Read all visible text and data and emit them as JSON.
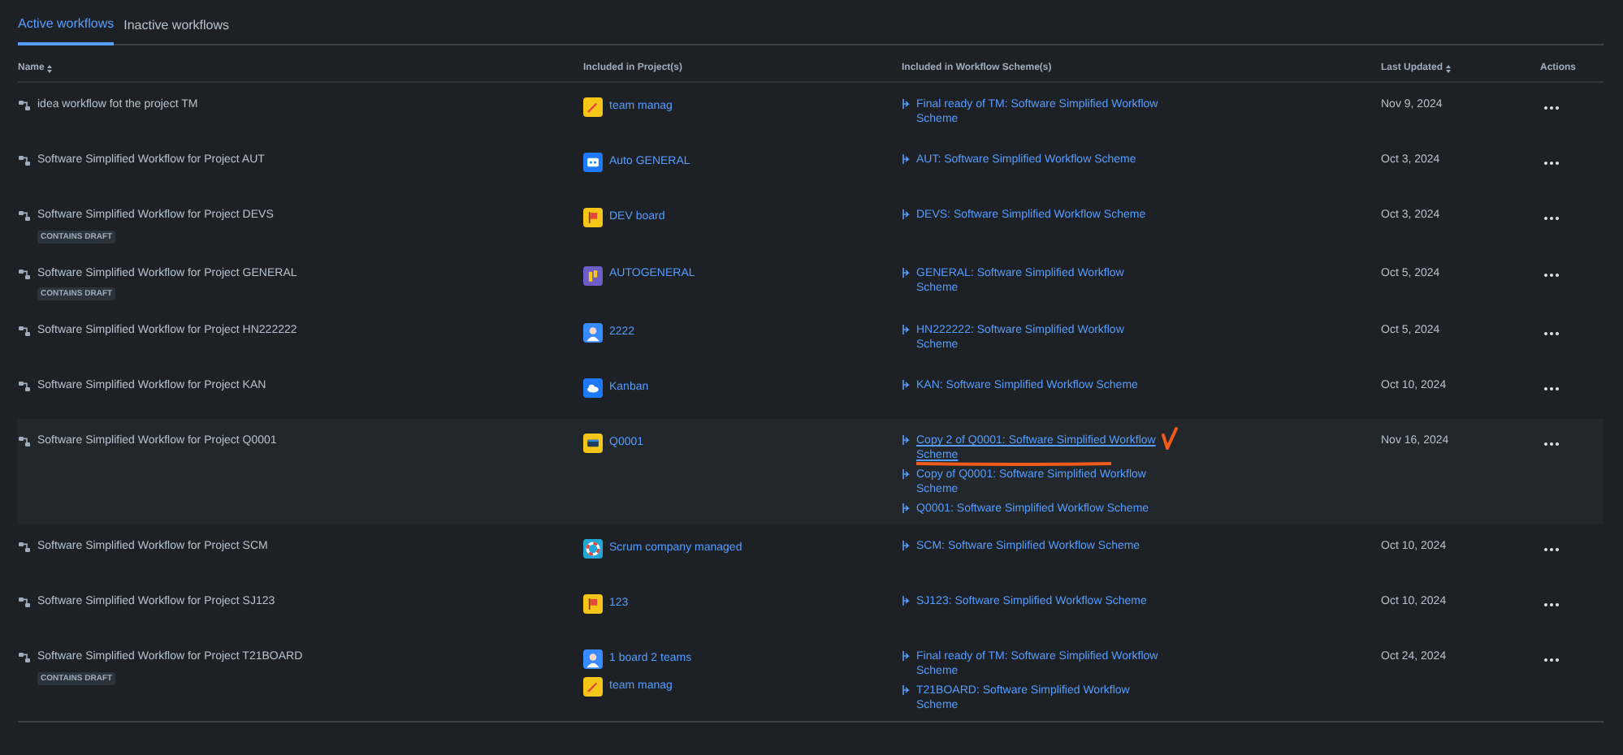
{
  "tabs": [
    {
      "label": "Active workflows",
      "selected": true
    },
    {
      "label": "Inactive workflows",
      "selected": false
    }
  ],
  "columns": [
    {
      "label": "Name",
      "kind": "sortable"
    },
    {
      "label": "Included in Project(s)",
      "kind": "plain"
    },
    {
      "label": "Included in Workflow Scheme(s)",
      "kind": "plain"
    },
    {
      "label": "Last Updated",
      "kind": "sortable"
    },
    {
      "label": "Actions",
      "kind": "plain"
    }
  ],
  "rows": [
    {
      "name": "idea workflow fot the project TM",
      "highlighted": false,
      "projects": [
        {
          "name": "team manag",
          "kind": "pencil",
          "color": "#f5c518"
        }
      ],
      "schemes": [
        {
          "name": "Final ready of TM: Software Simplified Workflow Scheme",
          "annotated": false
        }
      ],
      "updated": "Nov 9, 2024"
    },
    {
      "name": "Software Simplified Workflow for Project AUT",
      "highlighted": false,
      "projects": [
        {
          "name": "Auto GENERAL",
          "kind": "robot",
          "color": "#1d7afc"
        }
      ],
      "schemes": [
        {
          "name": "AUT: Software Simplified Workflow Scheme",
          "annotated": false
        }
      ],
      "updated": "Oct 3, 2024"
    },
    {
      "name": "Software Simplified Workflow for Project DEVS",
      "draft_label": "CONTAINS DRAFT",
      "highlighted": false,
      "projects": [
        {
          "name": "DEV board",
          "kind": "flag",
          "color": "#f5c518"
        }
      ],
      "schemes": [
        {
          "name": "DEVS: Software Simplified Workflow Scheme",
          "annotated": false
        }
      ],
      "updated": "Oct 3, 2024"
    },
    {
      "name": "Software Simplified Workflow for Project GENERAL",
      "draft_label": "CONTAINS DRAFT",
      "highlighted": false,
      "projects": [
        {
          "name": "AUTOGENERAL",
          "kind": "bars",
          "color": "#6e5dc6"
        }
      ],
      "schemes": [
        {
          "name": "GENERAL: Software Simplified Workflow Scheme",
          "annotated": false
        }
      ],
      "updated": "Oct 5, 2024"
    },
    {
      "name": "Software Simplified Workflow for Project HN222222",
      "highlighted": false,
      "projects": [
        {
          "name": "2222",
          "kind": "person",
          "color": "#388bff"
        }
      ],
      "schemes": [
        {
          "name": "HN222222: Software Simplified Workflow Scheme",
          "annotated": false
        }
      ],
      "updated": "Oct 5, 2024"
    },
    {
      "name": "Software Simplified Workflow for Project KAN",
      "highlighted": false,
      "projects": [
        {
          "name": "Kanban",
          "kind": "cloud",
          "color": "#1d7afc"
        }
      ],
      "schemes": [
        {
          "name": "KAN: Software Simplified Workflow Scheme",
          "annotated": false
        }
      ],
      "updated": "Oct 10, 2024"
    },
    {
      "name": "Software Simplified Workflow for Project Q0001",
      "highlighted": true,
      "projects": [
        {
          "name": "Q0001",
          "kind": "card",
          "color": "#f5c518"
        }
      ],
      "schemes": [
        {
          "name": "Copy 2 of Q0001: Software Simplified Workflow Scheme",
          "annotated": true
        },
        {
          "name": "Copy of Q0001: Software Simplified Workflow Scheme",
          "annotated": false
        },
        {
          "name": "Q0001: Software Simplified Workflow Scheme",
          "annotated": false
        }
      ],
      "updated": "Nov 16, 2024"
    },
    {
      "name": "Software Simplified Workflow for Project SCM",
      "highlighted": false,
      "projects": [
        {
          "name": "Scrum company managed",
          "kind": "ring",
          "color": "#22a6d6"
        }
      ],
      "schemes": [
        {
          "name": "SCM: Software Simplified Workflow Scheme",
          "annotated": false
        }
      ],
      "updated": "Oct 10, 2024"
    },
    {
      "name": "Software Simplified Workflow for Project SJ123",
      "highlighted": false,
      "projects": [
        {
          "name": "123",
          "kind": "flag",
          "color": "#f5c518"
        }
      ],
      "schemes": [
        {
          "name": "SJ123: Software Simplified Workflow Scheme",
          "annotated": false
        }
      ],
      "updated": "Oct 10, 2024"
    },
    {
      "name": "Software Simplified Workflow for Project T21BOARD",
      "draft_label": "CONTAINS DRAFT",
      "highlighted": false,
      "projects": [
        {
          "name": "1 board 2 teams",
          "kind": "person",
          "color": "#388bff"
        },
        {
          "name": "team manag",
          "kind": "pencil",
          "color": "#f5c518"
        }
      ],
      "schemes": [
        {
          "name": "Final ready of TM: Software Simplified Workflow Scheme",
          "annotated": false
        },
        {
          "name": "T21BOARD: Software Simplified Workflow Scheme",
          "annotated": false
        }
      ],
      "updated": "Oct 24, 2024"
    }
  ]
}
